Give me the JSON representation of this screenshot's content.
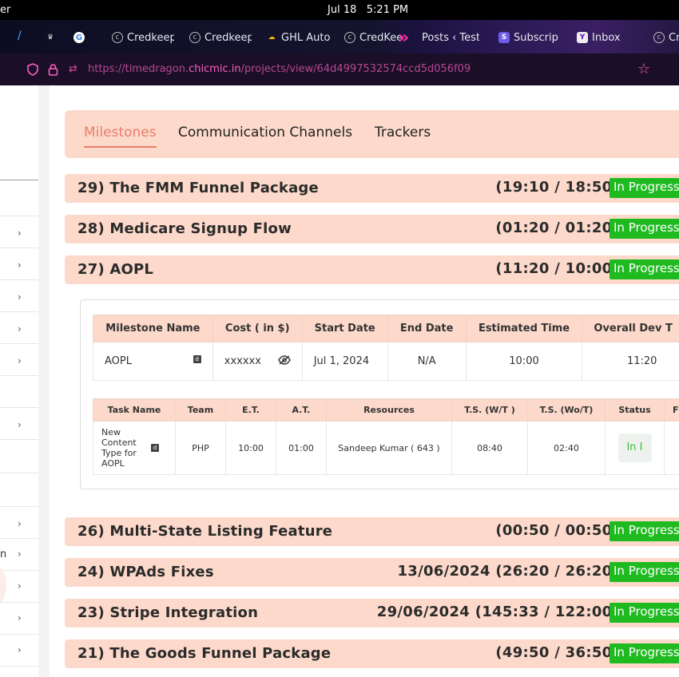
{
  "os": {
    "left_text": "er",
    "date": "Jul 18",
    "time": "5:21 PM"
  },
  "browser": {
    "tabs": [
      {
        "label": "Credkeep",
        "icon": "credkeep-icon"
      },
      {
        "label": "Credkeep",
        "icon": "credkeep-icon"
      },
      {
        "label": "GHL Auto",
        "icon": "ghl-icon"
      },
      {
        "label": "CredKee",
        "icon": "credkeep-icon"
      },
      {
        "label": "Posts ‹ Test",
        "icon": "chevrons-icon"
      },
      {
        "label": "Subscrip",
        "icon": "substack-icon"
      },
      {
        "label": "Inbox",
        "icon": "yahoo-icon"
      },
      {
        "label": "Cr",
        "icon": "credkeep-icon"
      }
    ],
    "url_prefix": "https://timedragon.",
    "url_domain": "chicmic.in",
    "url_path": "/projects/view/64d4997532574ccd5d056f09"
  },
  "project_tabs": [
    "Milestones",
    "Communication Channels",
    "Trackers"
  ],
  "milestones": [
    {
      "title": "29) The FMM Funnel Package",
      "time": "(19:10 / 18:50)",
      "status": "In Progress"
    },
    {
      "title": "28) Medicare Signup Flow",
      "time": "(01:20 / 01:20)",
      "status": "In Progress"
    },
    {
      "title": "27) AOPL",
      "time": "(11:20 / 10:00)",
      "status": "In Progress"
    },
    {
      "title": "26) Multi-State Listing Feature",
      "time": "(00:50 / 00:50)",
      "status": "In Progress"
    },
    {
      "title": "24) WPAds Fixes",
      "time": "13/06/2024 (26:20 / 26:20)",
      "status": "In Progress"
    },
    {
      "title": "23) Stripe Integration",
      "time": "29/06/2024 (145:33 / 122:00)",
      "status": "In Progress"
    },
    {
      "title": "21) The Goods Funnel Package",
      "time": "(49:50 / 36:50)",
      "status": "In Progress"
    }
  ],
  "milestone_table": {
    "headers": [
      "Milestone Name",
      "Cost ( in $)",
      "Start Date",
      "End Date",
      "Estimated Time",
      "Overall Dev T"
    ],
    "row": {
      "name": "AOPL",
      "cost": "xxxxxx",
      "start": "Jul 1, 2024",
      "end": "N/A",
      "estimated": "10:00",
      "overall": "11:20"
    }
  },
  "task_table": {
    "headers": [
      "Task Name",
      "Team",
      "E.T.",
      "A.T.",
      "Resources",
      "T.S. (W/T )",
      "T.S. (Wo/T)",
      "Status",
      "F"
    ],
    "row": {
      "task": "New Content Type for AOPL",
      "team": "PHP",
      "et": "10:00",
      "at": "01:00",
      "resources": "Sandeep Kumar ( 643 )",
      "ts_wt": "08:40",
      "ts_wot": "02:40",
      "status": "In I"
    }
  },
  "sidebar": {
    "partial_text": "n"
  }
}
